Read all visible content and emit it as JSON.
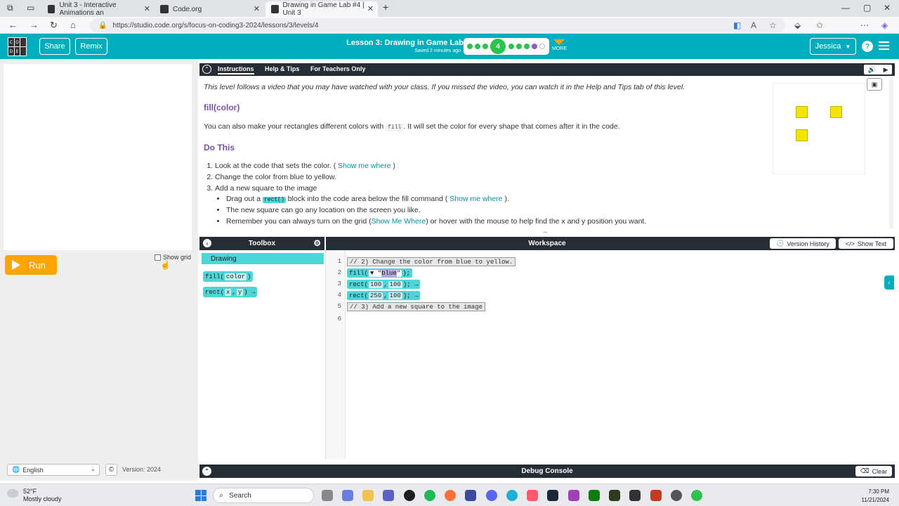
{
  "browser": {
    "tabs": [
      {
        "title": "Unit 3 - Interactive Animations an",
        "close": "✕"
      },
      {
        "title": "Code.org",
        "close": "✕"
      },
      {
        "title": "Drawing in Game Lab #4 | Unit 3",
        "close": "✕"
      }
    ],
    "new_tab": "+",
    "url": "https://studio.code.org/s/focus-on-coding3-2024/lessons/3/levels/4",
    "window_controls": {
      "minimize": "—",
      "maximize": "▢",
      "close": "✕"
    }
  },
  "header": {
    "logo_letters": [
      "C",
      "O",
      "",
      "D",
      "E",
      ""
    ],
    "share_label": "Share",
    "remix_label": "Remix",
    "lesson_title": "Lesson 3: Drawing in Game Lab",
    "saved_status": "Saved 2 minutes ago",
    "current_level": "4",
    "more_label": "MORE",
    "user_name": "Jessica",
    "help_icon": "?",
    "accent_color": "#00adbc",
    "progress_colors": {
      "completed": "#2cc24c",
      "assessment": "#8e5dbf"
    }
  },
  "left": {
    "run_label": "Run",
    "show_grid_label": "Show grid",
    "language": "English",
    "version_label": "Version: 2024",
    "copyright_icon": "©"
  },
  "instructions": {
    "tabs": [
      "Instructions",
      "Help & Tips",
      "For Teachers Only"
    ],
    "intro": "This level follows a video that you may have watched with your class. If you missed the video, you can watch it in the Help and Tips tab of this level.",
    "fill_heading": "fill(color)",
    "fill_text_before": "You can also make your rectangles different colors with",
    "fill_code": "fill",
    "fill_text_after": ". It will set the color for every shape that comes after it in the code.",
    "do_this_heading": "Do This",
    "step1_text": "Look at the code that sets the color. (",
    "step1_link": "Show me where",
    "step1_close": ")",
    "step2_text": "Change the color from blue to yellow.",
    "step3_text": "Add a new square to the image",
    "sub1_before": "Drag out a",
    "sub1_chip": "rect()",
    "sub1_after": "block into the code area below the fill command (",
    "sub1_link": "Show me where",
    "sub1_close": ").",
    "sub2_text": "The new square can go any location on the screen you like.",
    "sub3_before": "Remember you can always turn on the grid (",
    "sub3_link": "Show Me Where",
    "sub3_after": ") or hover with the mouse to help find the x and y position you want.",
    "square_color": "#f5e400"
  },
  "toolbox": {
    "title": "Toolbox",
    "category": "Drawing",
    "blocks": [
      {
        "name": "fill",
        "params": [
          "color"
        ]
      },
      {
        "name": "rect",
        "params": [
          "x",
          "y"
        ],
        "more": "→"
      }
    ]
  },
  "workspace": {
    "title": "Workspace",
    "version_history_label": "Version History",
    "show_text_label": "Show Text",
    "lines": [
      "1",
      "2",
      "3",
      "4",
      "5",
      "6"
    ],
    "code": {
      "line1": "// 2) Change the color from blue to yellow.",
      "line2_fn": "fill(",
      "line2_dd": "▼",
      "line2_q1": "\"",
      "line2_str": "blue",
      "line2_q2": "\"",
      "line2_end": ");",
      "line3_fn": "rect(",
      "line3_a1": "100",
      "line3_sep": ",",
      "line3_a2": "100",
      "line3_end": "); →",
      "line4_fn": "rect(",
      "line4_a1": "250",
      "line4_sep": ",",
      "line4_a2": "100",
      "line4_end": "); →",
      "line5": "// 3) Add a new square to the image"
    }
  },
  "debug": {
    "title": "Debug Console",
    "clear_label": "Clear"
  },
  "taskbar": {
    "temperature": "52°F",
    "weather": "Mostly cloudy",
    "search_placeholder": "Search",
    "time": "7:30 PM",
    "date": "11/21/2024"
  }
}
